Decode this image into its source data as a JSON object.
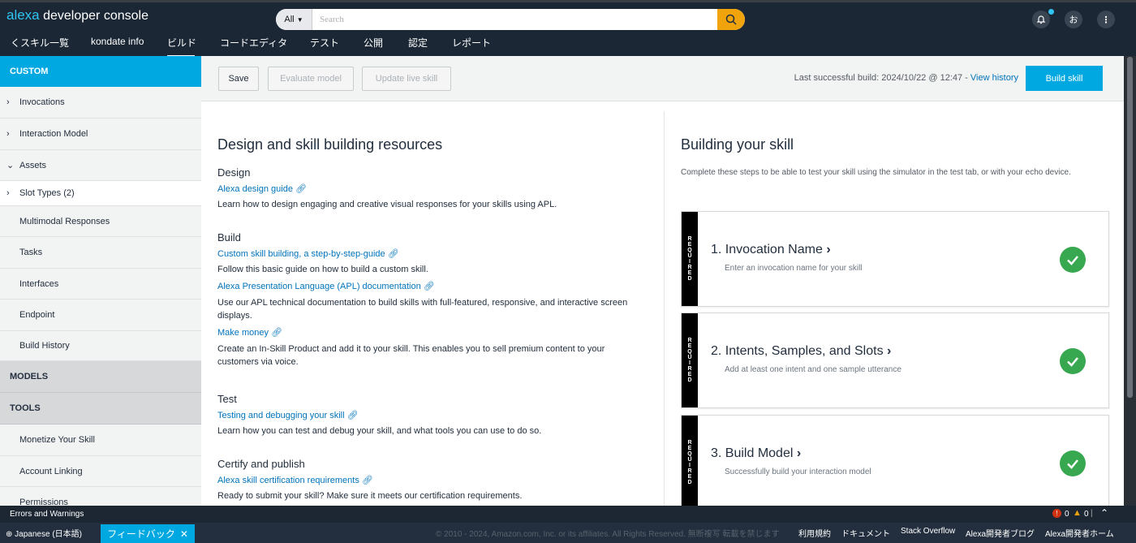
{
  "header": {
    "brand_alexa": "alexa",
    "brand_rest": "developer console",
    "search_scope": "All",
    "search_placeholder": "Search",
    "user_initial": "お"
  },
  "nav": {
    "back": "くスキル一覧",
    "skill_name": "kondate info",
    "tabs": [
      "ビルド",
      "コードエディタ",
      "テスト",
      "公開",
      "認定",
      "レポート"
    ]
  },
  "sidebar": {
    "custom_label": "CUSTOM",
    "items": [
      {
        "label": "Invocations",
        "caret": "›"
      },
      {
        "label": "Interaction Model",
        "caret": "›"
      },
      {
        "label": "Assets",
        "caret": "⌄"
      },
      {
        "label": "Slot Types (2)",
        "caret": "›"
      },
      {
        "label": "Multimodal Responses"
      },
      {
        "label": "Tasks"
      },
      {
        "label": "Interfaces"
      },
      {
        "label": "Endpoint"
      },
      {
        "label": "Build History"
      }
    ],
    "models_label": "MODELS",
    "tools_label": "TOOLS",
    "tools_items": [
      "Monetize Your Skill",
      "Account Linking",
      "Permissions"
    ]
  },
  "toolbar": {
    "save": "Save",
    "evaluate": "Evaluate model",
    "update_live": "Update live skill",
    "last_build": "Last successful build: 2024/10/22 @ 12:47 - ",
    "view_history": "View history",
    "build": "Build skill"
  },
  "resources": {
    "title": "Design and skill building resources",
    "design": {
      "heading": "Design",
      "link": "Alexa design guide",
      "text": "Learn how to design engaging and creative visual responses for your skills using APL."
    },
    "build": {
      "heading": "Build",
      "link1": "Custom skill building, a step-by-step-guide",
      "text1": "Follow this basic guide on how to build a custom skill.",
      "link2": "Alexa Presentation Language (APL) documentation",
      "text2": "Use our APL technical documentation to build skills with full-featured, responsive, and interactive screen displays.",
      "link3": "Make money",
      "text3": "Create an In-Skill Product and add it to your skill. This enables you to sell premium content to your customers via voice."
    },
    "test": {
      "heading": "Test",
      "link": "Testing and debugging your skill",
      "text": "Learn how you can test and debug your skill, and what tools you can use to do so."
    },
    "certify": {
      "heading": "Certify and publish",
      "link": "Alexa skill certification requirements",
      "text": "Ready to submit your skill? Make sure it meets our certification requirements."
    }
  },
  "building": {
    "title": "Building your skill",
    "subtitle": "Complete these steps to be able to test your skill using the simulator in the test tab, or with your echo device.",
    "required": "REQUIRED",
    "steps": [
      {
        "title": "1. Invocation Name",
        "sub": "Enter an invocation name for your skill"
      },
      {
        "title": "2. Intents, Samples, and Slots",
        "sub": "Add at least one intent and one sample utterance"
      },
      {
        "title": "3. Build Model",
        "sub": "Successfully build your interaction model"
      }
    ]
  },
  "status": {
    "errors_label": "Errors and Warnings",
    "error_count": "0",
    "warning_count": "0"
  },
  "footer": {
    "language": "Japanese (日本語)",
    "feedback": "フィードバック",
    "copyright": "© 2010 - 2024, Amazon.com, Inc. or its affiliates. All Rights Reserved. 無断複写 転載を禁じます",
    "links": [
      "利用規約",
      "ドキュメント",
      "Stack Overflow",
      "Alexa開発者ブログ",
      "Alexa開発者ホーム"
    ]
  },
  "colors": {
    "accent": "#00a8e1",
    "header_bg": "#1b2735",
    "link": "#0073bb",
    "success": "#37a84f",
    "search_button": "#f0a30a"
  }
}
